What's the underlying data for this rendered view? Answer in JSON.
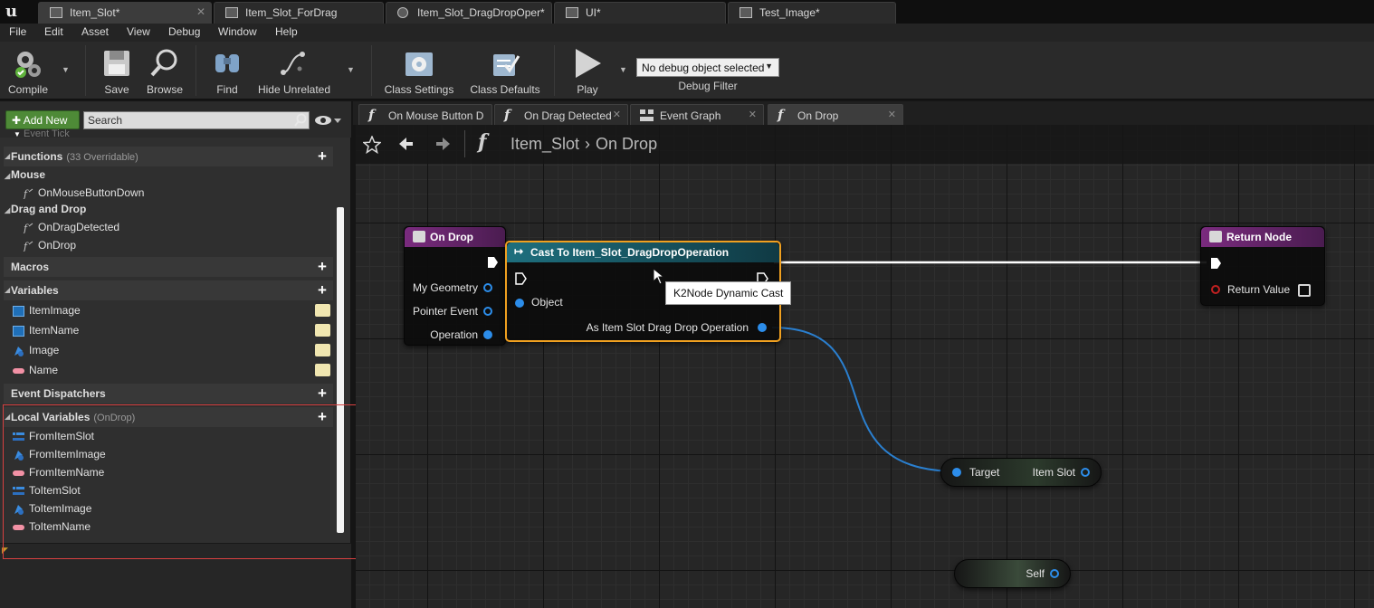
{
  "doc_tabs": [
    {
      "label": "Item_Slot*",
      "active": true
    },
    {
      "label": "Item_Slot_ForDrag",
      "active": false
    },
    {
      "label": "Item_Slot_DragDropOper*",
      "active": false
    },
    {
      "label": "UI*",
      "active": false
    },
    {
      "label": "Test_Image*",
      "active": false
    }
  ],
  "menu": [
    "File",
    "Edit",
    "Asset",
    "View",
    "Debug",
    "Window",
    "Help"
  ],
  "toolbar": {
    "compile": "Compile",
    "save": "Save",
    "browse": "Browse",
    "find": "Find",
    "hide_unrelated": "Hide Unrelated",
    "class_settings": "Class Settings",
    "class_defaults": "Class Defaults",
    "play": "Play",
    "debug_select": "No debug object selected",
    "debug_filter": "Debug Filter"
  },
  "my_blueprint": {
    "add_new": "Add New",
    "search_placeholder": "Search",
    "cut_off_item": "Event Tick",
    "functions": {
      "label": "Functions",
      "sub": "(33 Overridable)"
    },
    "categories": [
      {
        "label": "Mouse",
        "items": [
          "OnMouseButtonDown"
        ]
      },
      {
        "label": "Drag and Drop",
        "items": [
          "OnDragDetected",
          "OnDrop"
        ]
      }
    ],
    "macros": "Macros",
    "variables": {
      "label": "Variables",
      "items": [
        "ItemImage",
        "ItemName",
        "Image",
        "Name"
      ]
    },
    "event_dispatchers": "Event Dispatchers",
    "local_variables": {
      "label": "Local Variables",
      "sub": "(OnDrop)",
      "items": [
        "FromItemSlot",
        "FromItemImage",
        "FromItemName",
        "ToItemSlot",
        "ToItemImage",
        "ToItemName"
      ]
    }
  },
  "graph_tabs": [
    {
      "label": "On Mouse Button D",
      "icon": "function-icon"
    },
    {
      "label": "On Drag Detected",
      "icon": "function-icon"
    },
    {
      "label": "Event Graph",
      "icon": "event-graph-icon"
    },
    {
      "label": "On Drop",
      "icon": "function-icon",
      "active": true
    }
  ],
  "breadcrumb": {
    "root": "Item_Slot",
    "current": "On Drop"
  },
  "nodes": {
    "on_drop": {
      "title": "On Drop",
      "pins": [
        "My Geometry",
        "Pointer Event",
        "Operation"
      ]
    },
    "cast": {
      "title": "Cast To Item_Slot_DragDropOperation",
      "object_pin": "Object",
      "output_pin": "As Item Slot Drag Drop Operation"
    },
    "return": {
      "title": "Return Node",
      "pin": "Return Value"
    },
    "getter": {
      "input": "Target",
      "output": "Item Slot"
    },
    "self": {
      "label": "Self"
    }
  },
  "tooltip": "K2Node Dynamic Cast",
  "colors": {
    "function_header": "#7a2b7e",
    "cast_header": "#1e6f7e",
    "object_pin": "#2c8dea",
    "selected_outline": "#f0a020",
    "add_new": "#4e8a37"
  }
}
